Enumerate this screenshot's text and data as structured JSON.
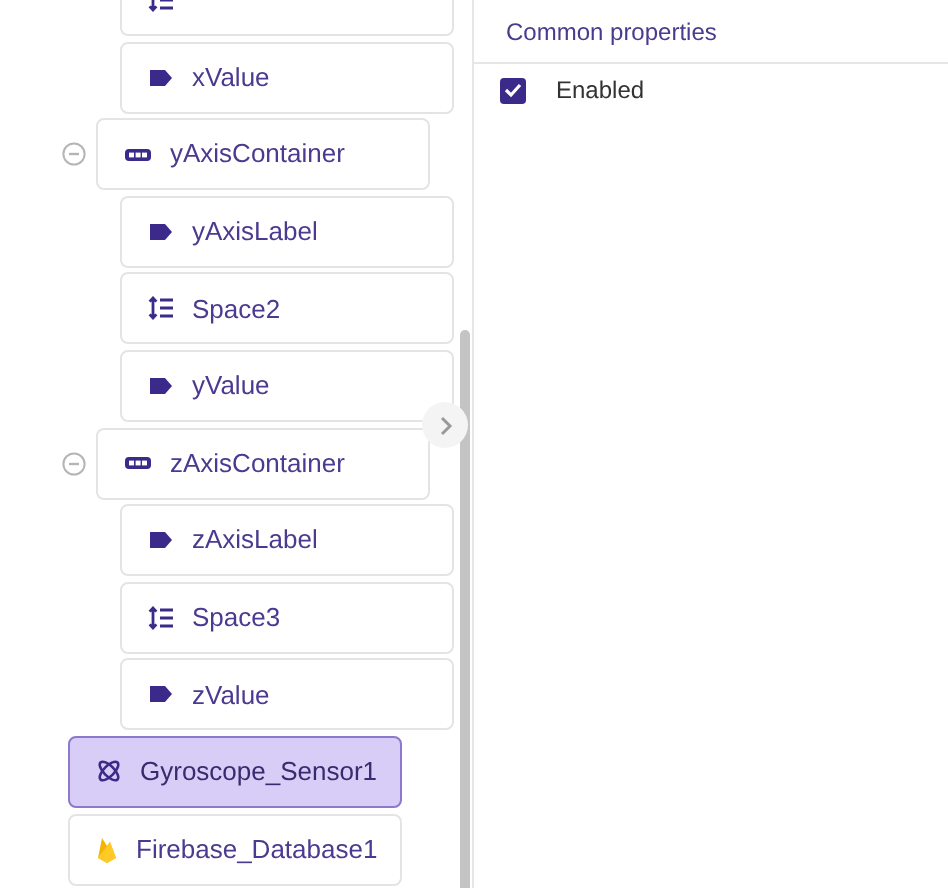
{
  "tree": [
    {
      "children": [
        {
          "children": [
            {
              "kind": "space",
              "selected": false
            },
            {
              "label": "xValue",
              "kind": "label",
              "selected": false
            }
          ]
        },
        {
          "label": "yAxisContainer",
          "kind": "arrangement",
          "expanded": true,
          "selected": false,
          "children": [
            {
              "label": "yAxisLabel",
              "kind": "label",
              "selected": false
            },
            {
              "label": "Space2",
              "kind": "space",
              "selected": false
            },
            {
              "label": "yValue",
              "kind": "label",
              "selected": false
            }
          ]
        },
        {
          "label": "zAxisContainer",
          "kind": "arrangement",
          "expanded": true,
          "selected": false,
          "children": [
            {
              "label": "zAxisLabel",
              "kind": "label",
              "selected": false
            },
            {
              "label": "Space3",
              "kind": "space",
              "selected": false
            },
            {
              "label": "zValue",
              "kind": "label",
              "selected": false
            }
          ]
        }
      ]
    },
    {
      "label": "Gyroscope_Sensor1",
      "kind": "gyroscope",
      "selected": true
    },
    {
      "label": "Firebase_Database1",
      "kind": "firebase",
      "selected": false
    }
  ],
  "properties": {
    "title": "Common properties",
    "items": [
      {
        "label": "Enabled",
        "kind": "checkbox",
        "checked": true
      }
    ]
  }
}
